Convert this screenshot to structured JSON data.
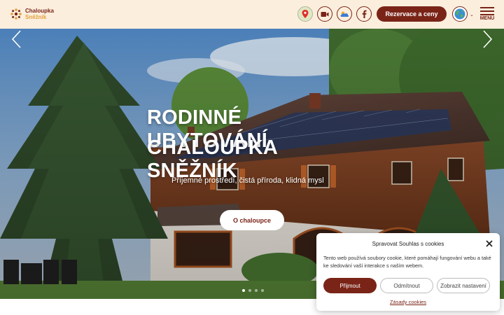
{
  "header": {
    "logo_line1": "Chaloupka",
    "logo_line2": "Sněžník",
    "cta_label": "Rezervace a ceny",
    "menu_label": "MENU",
    "icons": [
      "map-pin-icon",
      "video-camera-icon",
      "weather-icon",
      "facebook-icon",
      "globe-icon"
    ]
  },
  "hero": {
    "title_line1": "RODINNÉ UBYTOVÁNÍ",
    "title_line2": "CHALOUPKA SNĚŽNÍK",
    "subtitle": "Příjemné prostředí, čistá příroda, klidná mysl",
    "button_label": "O chaloupce",
    "slides_total": 4,
    "active_slide": 1
  },
  "cookie": {
    "title": "Spravovat Souhlas s cookies",
    "text": "Tento web používá soubory cookie, které pomáhají fungování webu a také ke sledování vaší interakce s naším webem.",
    "accept_label": "Přijmout",
    "deny_label": "Odmítnout",
    "prefs_label": "Zobrazit nastavení",
    "policy_label": "Zásady cookies"
  },
  "colors": {
    "brand": "#7a2418",
    "accent": "#e2a13b",
    "header_bg": "#fbeedd"
  }
}
